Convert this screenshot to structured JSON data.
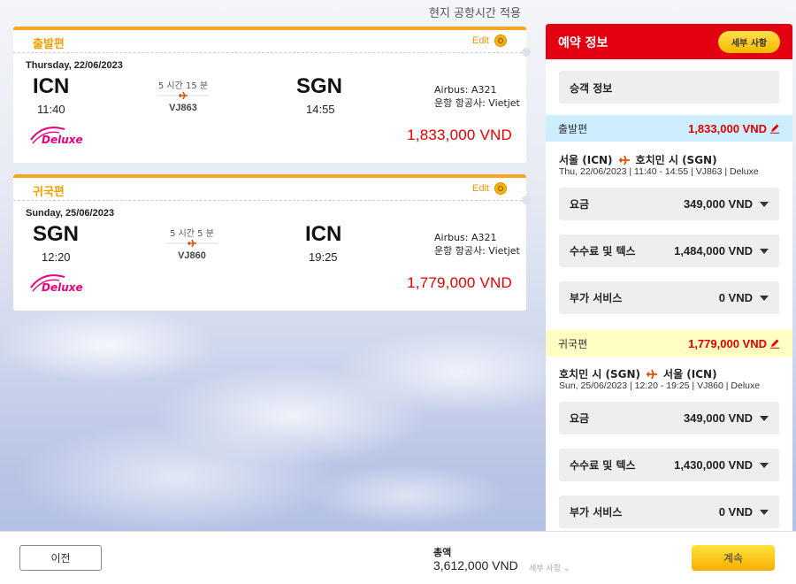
{
  "header": {
    "timezone_note": "현지 공항시간 적용"
  },
  "flights": [
    {
      "title": "출발편",
      "edit_label": "Edit",
      "date": "Thursday, 22/06/2023",
      "from_code": "ICN",
      "from_time": "11:40",
      "to_code": "SGN",
      "to_time": "14:55",
      "duration": "5 시간 15 분",
      "flight_no": "VJ863",
      "aircraft": "Airbus: A321",
      "operator": "운항 항공사: Vietjet",
      "fare_class": "Deluxe",
      "price": "1,833,000 VND"
    },
    {
      "title": "귀국편",
      "edit_label": "Edit",
      "date": "Sunday, 25/06/2023",
      "from_code": "SGN",
      "from_time": "12:20",
      "to_code": "ICN",
      "to_time": "19:25",
      "duration": "5 시간 5 분",
      "flight_no": "VJ860",
      "aircraft": "Airbus: A321",
      "operator": "운항 항공사: Vietjet",
      "fare_class": "Deluxe",
      "price": "1,779,000 VND"
    }
  ],
  "summary": {
    "title": "예약 정보",
    "details_button": "세부 사항",
    "passenger_info": "승객 정보",
    "segments": [
      {
        "label": "출발편",
        "amount": "1,833,000 VND",
        "bar_color": "#cceeff",
        "route_from": "서울 (ICN)",
        "route_to": "호치민 시 (SGN)",
        "route_detail": "Thu, 22/06/2023 | 11:40 - 14:55 | VJ863 | Deluxe",
        "fees": [
          {
            "name": "요금",
            "value": "349,000 VND"
          },
          {
            "name": "수수료 및 텍스",
            "value": "1,484,000 VND"
          },
          {
            "name": "부가 서비스",
            "value": "0 VND"
          }
        ]
      },
      {
        "label": "귀국편",
        "amount": "1,779,000 VND",
        "bar_color": "#ffffc4",
        "route_from": "호치민 시 (SGN)",
        "route_to": "서울 (ICN)",
        "route_detail": "Sun, 25/06/2023 | 12:20 - 19:25 | VJ860 | Deluxe",
        "fees": [
          {
            "name": "요금",
            "value": "349,000 VND"
          },
          {
            "name": "수수료 및 텍스",
            "value": "1,430,000 VND"
          },
          {
            "name": "부가 서비스",
            "value": "0 VND"
          }
        ]
      }
    ]
  },
  "footer": {
    "prev_label": "이전",
    "total_label": "총액",
    "total_amount": "3,612,000 VND",
    "total_details": "세부 사항",
    "next_label": "계속"
  },
  "colors": {
    "accent_red": "#e30010",
    "accent_yellow": "#f5a623",
    "price_red": "#e00000"
  }
}
